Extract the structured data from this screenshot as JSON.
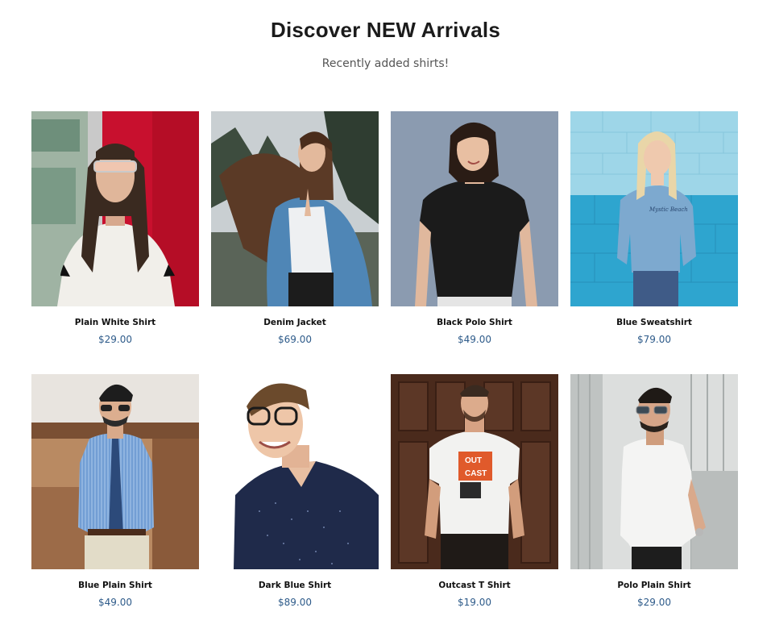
{
  "header": {
    "title": "Discover NEW Arrivals",
    "subtitle": "Recently added shirts!"
  },
  "products": [
    {
      "name": "Plain White Shirt",
      "price": "$29.00",
      "image_icon": "woman-white-tee-photo"
    },
    {
      "name": "Denim Jacket",
      "price": "$69.00",
      "image_icon": "woman-denim-jacket-photo"
    },
    {
      "name": "Black Polo Shirt",
      "price": "$49.00",
      "image_icon": "woman-black-polo-photo"
    },
    {
      "name": "Blue Sweatshirt",
      "price": "$79.00",
      "image_icon": "woman-blue-sweatshirt-photo"
    },
    {
      "name": "Blue Plain Shirt",
      "price": "$49.00",
      "image_icon": "man-blue-shirt-tie-photo"
    },
    {
      "name": "Dark Blue Shirt",
      "price": "$89.00",
      "image_icon": "man-dark-shirt-glasses-photo"
    },
    {
      "name": "Outcast T Shirt",
      "price": "$19.00",
      "image_icon": "man-outcast-tee-photo"
    },
    {
      "name": "Polo Plain Shirt",
      "price": "$29.00",
      "image_icon": "man-white-shirt-photo"
    }
  ],
  "graphics": {
    "outcast_print_line1": "OUT",
    "outcast_print_line2": "CAST",
    "sweatshirt_print": "Mystic Beach"
  },
  "colors": {
    "price": "#2e5b8a",
    "title": "#1b1b1b"
  }
}
